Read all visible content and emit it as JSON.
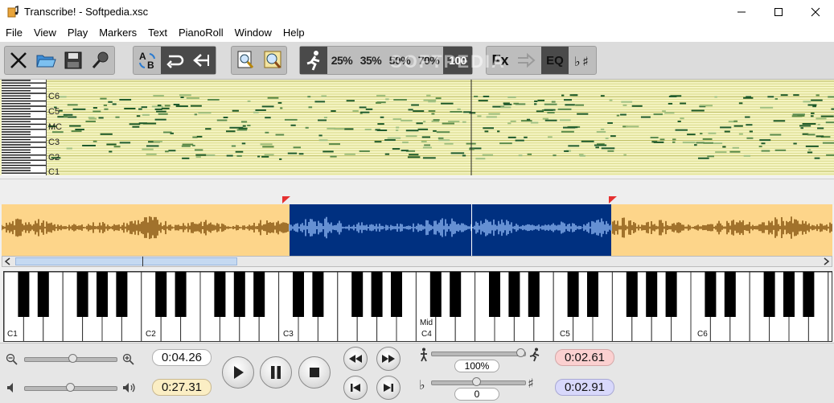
{
  "window": {
    "title": "Transcribe! - Softpedia.xsc"
  },
  "menu": [
    "File",
    "View",
    "Play",
    "Markers",
    "Text",
    "PianoRoll",
    "Window",
    "Help"
  ],
  "toolbar": {
    "speed_buttons": [
      "25%",
      "35%",
      "50%",
      "70%",
      "100"
    ],
    "fx_label": "Fx",
    "eq_label": "EQ",
    "watermark": "SOFTPEDIA"
  },
  "pianoroll": {
    "note_labels": [
      "C6",
      "C5",
      "MC",
      "C3",
      "C2",
      "C1"
    ]
  },
  "keyboard": {
    "octave_labels": [
      "C1",
      "C2",
      "C3",
      "C4",
      "C5",
      "C6"
    ],
    "middle_label": "Mid"
  },
  "controls": {
    "position_time": "0:04.26",
    "total_time": "0:27.31",
    "speed_value": "100%",
    "pitch_value": "0",
    "selection_start": "0:02.61",
    "selection_end": "0:02.91",
    "colors": {
      "start_bg": "#fbd0d0",
      "end_bg": "#d8d8fb",
      "total_bg": "#fbeec4"
    }
  }
}
